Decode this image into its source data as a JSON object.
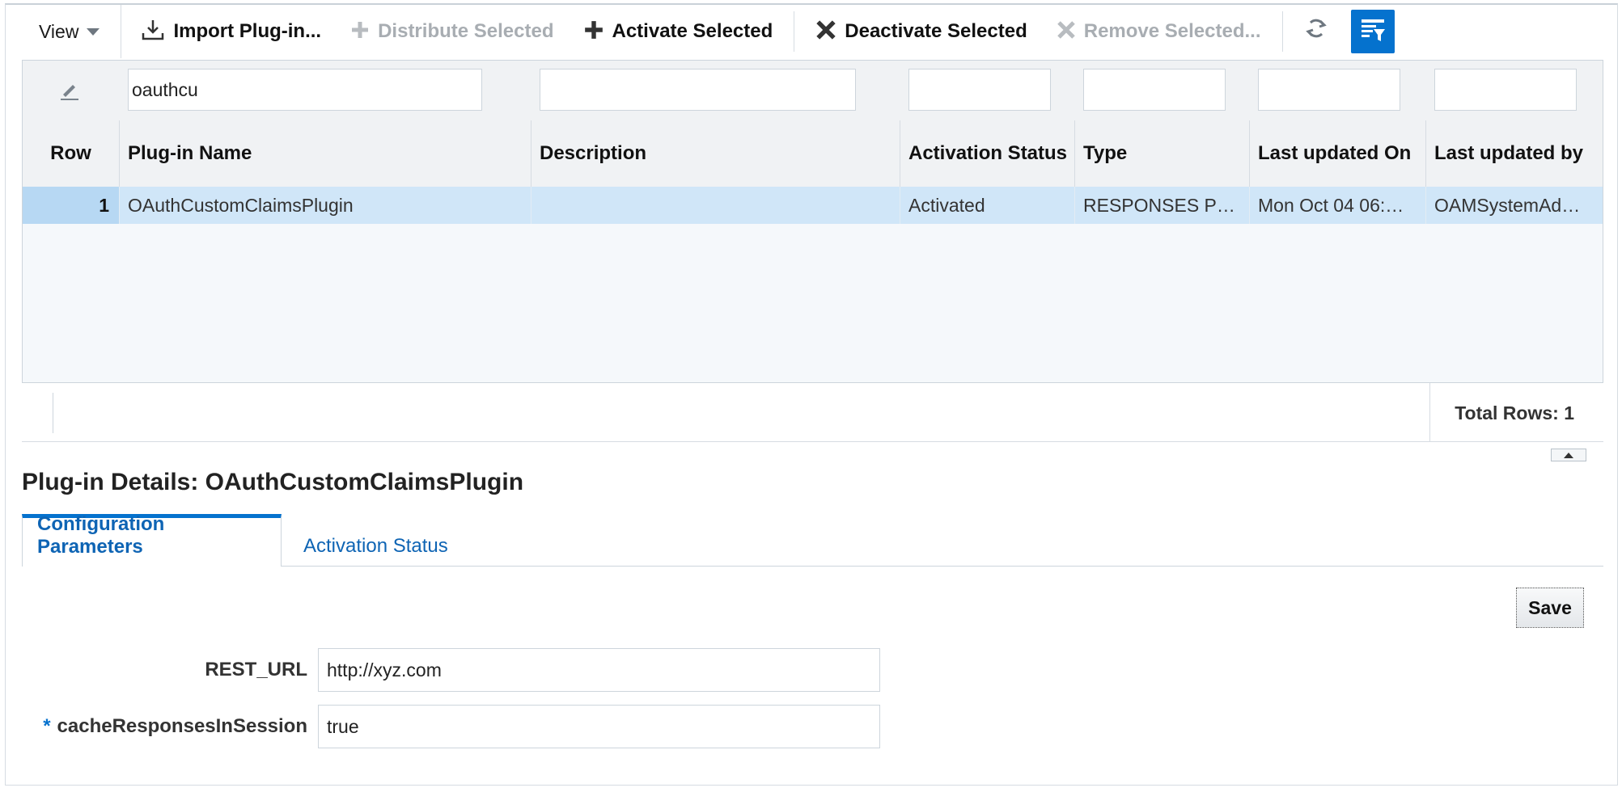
{
  "toolbar": {
    "view_label": "View",
    "import_label": "Import Plug-in...",
    "distribute_label": "Distribute Selected",
    "activate_label": "Activate Selected",
    "deactivate_label": "Deactivate Selected",
    "remove_label": "Remove Selected...",
    "refresh_icon": "refresh-icon",
    "qbe_icon": "query-by-example-icon",
    "accent": "#0572ce"
  },
  "table": {
    "filter": {
      "plugin_name": "oauthcu",
      "description": "",
      "activation_status": "",
      "type": "",
      "last_updated_on": "",
      "last_updated_by": ""
    },
    "columns": {
      "row": "Row",
      "plugin_name": "Plug-in Name",
      "description": "Description",
      "activation_status": "Activation Status",
      "type": "Type",
      "last_updated_on": "Last updated On",
      "last_updated_by": "Last updated by"
    },
    "rows": [
      {
        "row": "1",
        "plugin_name": "OAuthCustomClaimsPlugin",
        "description": "",
        "activation_status": "Activated",
        "type": "RESPONSES P…",
        "last_updated_on": "Mon Oct 04 06:…",
        "last_updated_by": "OAMSystemAd…"
      }
    ],
    "total_rows": "Total Rows: 1",
    "selected_row_color": "#d0e6f8"
  },
  "details": {
    "title": "Plug-in Details: OAuthCustomClaimsPlugin",
    "tabs": [
      "Configuration Parameters",
      "Activation Status"
    ],
    "save_label": "Save",
    "params": [
      {
        "label": "REST_URL",
        "value": "http://xyz.com",
        "required": ""
      },
      {
        "label": "cacheResponsesInSession",
        "value": "true",
        "required": "*"
      }
    ]
  }
}
